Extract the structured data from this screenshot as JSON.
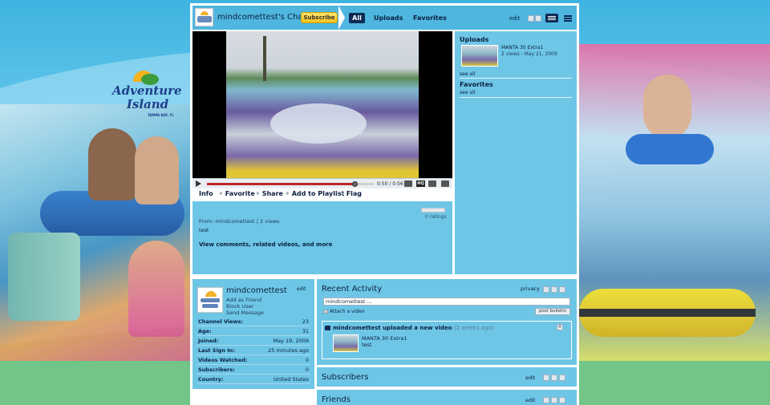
{
  "brand": {
    "logo_line1": "Adventure",
    "logo_line2": "Island",
    "logo_tagline": "TAMPA BAY, FL"
  },
  "channel": {
    "title": "mindcomettest's Channel",
    "subscribe_label": "Subscribe",
    "tabs": [
      {
        "label": "All",
        "active": true
      },
      {
        "label": "Uploads",
        "active": false
      },
      {
        "label": "Favorites",
        "active": false
      }
    ],
    "edit_label": "edit"
  },
  "player": {
    "timecode": "0:50 / 0:56",
    "progress_fraction": 0.89,
    "hq_label": "HQ"
  },
  "actions": {
    "info": "Info",
    "favorite": "Favorite",
    "share": "Share",
    "add_to_playlist": "Add to Playlist",
    "flag": "Flag"
  },
  "info": {
    "ratings": "0 ratings",
    "from_prefix": "From:",
    "from_user": "mindcomettest",
    "views": "2 views",
    "description": "test",
    "comments_link": "View comments, related videos, and more"
  },
  "side": {
    "uploads_title": "Uploads",
    "upload_video_title": "MANTA 30 Extra1",
    "upload_video_meta": "2 views - May 21, 2009",
    "see_all": "see all",
    "favorites_title": "Favorites"
  },
  "profile": {
    "name": "mindcomettest",
    "edit_label": "edit",
    "links": [
      "Add as Friend",
      "Block User",
      "Send Message"
    ],
    "stats": [
      {
        "key": "Channel Views:",
        "value": "23"
      },
      {
        "key": "Age:",
        "value": "31"
      },
      {
        "key": "Joined:",
        "value": "May 19, 2009"
      },
      {
        "key": "Last Sign In:",
        "value": "25 minutes ago"
      },
      {
        "key": "Videos Watched:",
        "value": "0"
      },
      {
        "key": "Subscribers:",
        "value": "0"
      },
      {
        "key": "Country:",
        "value": "United States"
      }
    ]
  },
  "recent": {
    "title": "Recent Activity",
    "privacy_label": "privacy",
    "status_value": "mindcomettest ...",
    "attach_label": "Attach a video",
    "post_label": "post bulletin",
    "item_text": "mindcomettest uploaded a new video",
    "item_ago": "(2 weeks ago)",
    "item_video_title": "MANTA 30 Extra1",
    "item_video_desc": "test"
  },
  "subscribers": {
    "title": "Subscribers",
    "edit_label": "edit"
  },
  "friends": {
    "title": "Friends",
    "edit_label": "edit"
  }
}
